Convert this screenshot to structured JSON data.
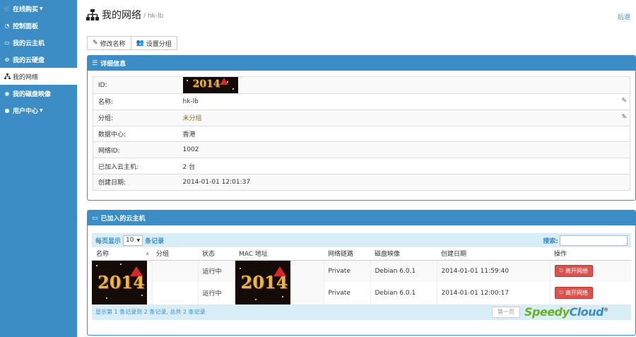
{
  "sidebar": {
    "items": [
      {
        "label": "在线购买",
        "icon": "cart-icon",
        "caret": true
      },
      {
        "label": "控制面板",
        "icon": "dashboard-icon"
      },
      {
        "label": "我的云主机",
        "icon": "desktop-icon"
      },
      {
        "label": "我的云硬盘",
        "icon": "hdd-icon"
      },
      {
        "label": "我的网络",
        "icon": "sitemap-icon",
        "active": true
      },
      {
        "label": "我的磁盘映像",
        "icon": "disc-icon"
      },
      {
        "label": "用户中心",
        "icon": "user-icon",
        "caret": true
      }
    ]
  },
  "header": {
    "title": "我的网络",
    "subtitle": "/ hk-lb",
    "logout": "后退"
  },
  "toolbar": {
    "rename": "修改名称",
    "group": "设置分组"
  },
  "details": {
    "title": "详细信息",
    "rows": [
      {
        "label": "ID:",
        "value": ""
      },
      {
        "label": "名称:",
        "value": "hk-lb"
      },
      {
        "label": "分组:",
        "value": "未分组"
      },
      {
        "label": "数据中心:",
        "value": "香港"
      },
      {
        "label": "网络ID:",
        "value": "1002"
      },
      {
        "label": "已加入云主机:",
        "value": "2 台"
      },
      {
        "label": "创建日期:",
        "value": "2014-01-01 12:01:37"
      }
    ]
  },
  "vms": {
    "title": "已加入的云主机",
    "per_page_prefix": "每页显示",
    "per_page_value": "10",
    "per_page_suffix": "条记录",
    "search_label": "搜索:",
    "columns": [
      "名称",
      "分组",
      "状态",
      "MAC 地址",
      "网络链路",
      "磁盘映像",
      "创建日期",
      "操作"
    ],
    "rows": [
      {
        "status": "运行中",
        "link": "Private",
        "image": "Debian 6.0.1",
        "created": "2014-01-01 11:59:40",
        "action": "离开网络"
      },
      {
        "status": "运行中",
        "link": "Private",
        "image": "Debian 6.0.1",
        "created": "2014-01-01 12:00:17",
        "action": "离开网络"
      }
    ],
    "footer": "显示第 1 条记录到 2 条记录, 总共 2 条记录",
    "first_page": "第一页"
  },
  "image_text": "2014",
  "watermark": {
    "part1": "Speedy",
    "part2": "Cloud",
    "mark": "®"
  },
  "colors": {
    "accent": "#3c8dc5",
    "danger": "#d9534f",
    "info_bg": "#d9edf7"
  }
}
